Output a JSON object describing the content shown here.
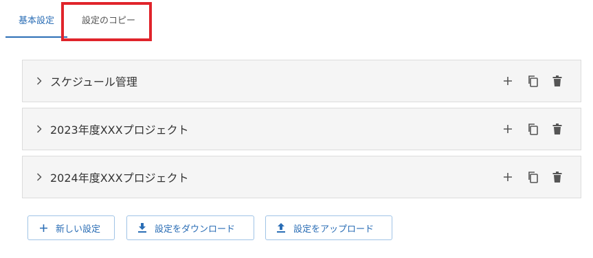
{
  "tabs": [
    {
      "label": "基本設定"
    },
    {
      "label": "設定のコピー"
    }
  ],
  "panels": [
    {
      "title": "スケジュール管理"
    },
    {
      "title": "2023年度XXXプロジェクト"
    },
    {
      "title": "2024年度XXXプロジェクト"
    }
  ],
  "buttons": {
    "new_label": "新しい設定",
    "download_label": "設定をダウンロード",
    "upload_label": "設定をアップロード"
  },
  "colors": {
    "accent": "#2a6db5",
    "highlight": "#e0242b",
    "panel_bg": "#f5f5f5",
    "icon": "#555555"
  },
  "icons": {
    "panel": [
      "chevron-right-icon",
      "plus-icon",
      "copy-icon",
      "trash-icon"
    ],
    "buttons": [
      "plus-icon",
      "download-icon",
      "upload-icon"
    ]
  }
}
